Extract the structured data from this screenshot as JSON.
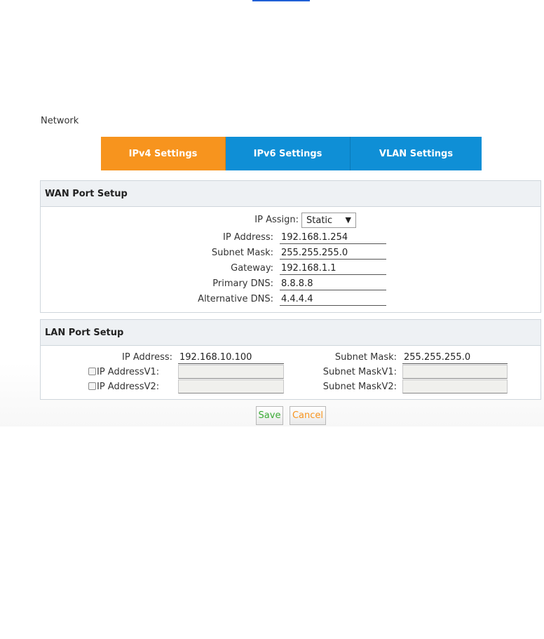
{
  "page": {
    "title": "Network"
  },
  "tabs": [
    {
      "label": "IPv4 Settings",
      "active": true
    },
    {
      "label": "IPv6 Settings",
      "active": false
    },
    {
      "label": "VLAN Settings",
      "active": false
    }
  ],
  "wan": {
    "header": "WAN Port Setup",
    "ip_assign_label": "IP Assign:",
    "ip_assign_value": "Static",
    "ip_address_label": "IP Address:",
    "ip_address_value": "192.168.1.254",
    "subnet_mask_label": "Subnet Mask:",
    "subnet_mask_value": "255.255.255.0",
    "gateway_label": "Gateway:",
    "gateway_value": "192.168.1.1",
    "primary_dns_label": "Primary DNS:",
    "primary_dns_value": "8.8.8.8",
    "alt_dns_label": "Alternative DNS:",
    "alt_dns_value": "4.4.4.4"
  },
  "lan": {
    "header": "LAN Port Setup",
    "ip_address_label": "IP Address:",
    "ip_address_value": "192.168.10.100",
    "subnet_mask_label": "Subnet Mask:",
    "subnet_mask_value": "255.255.255.0",
    "ip_v1_label": "IP AddressV1:",
    "ip_v1_value": "",
    "mask_v1_label": "Subnet MaskV1:",
    "mask_v1_value": "",
    "ip_v2_label": "IP AddressV2:",
    "ip_v2_value": "",
    "mask_v2_label": "Subnet MaskV2:",
    "mask_v2_value": ""
  },
  "buttons": {
    "save": "Save",
    "cancel": "Cancel"
  },
  "colors": {
    "tab_active": "#f7941e",
    "tab_inactive": "#0f8fd6",
    "save_text": "#3aaa35",
    "cancel_text": "#f7941e"
  }
}
